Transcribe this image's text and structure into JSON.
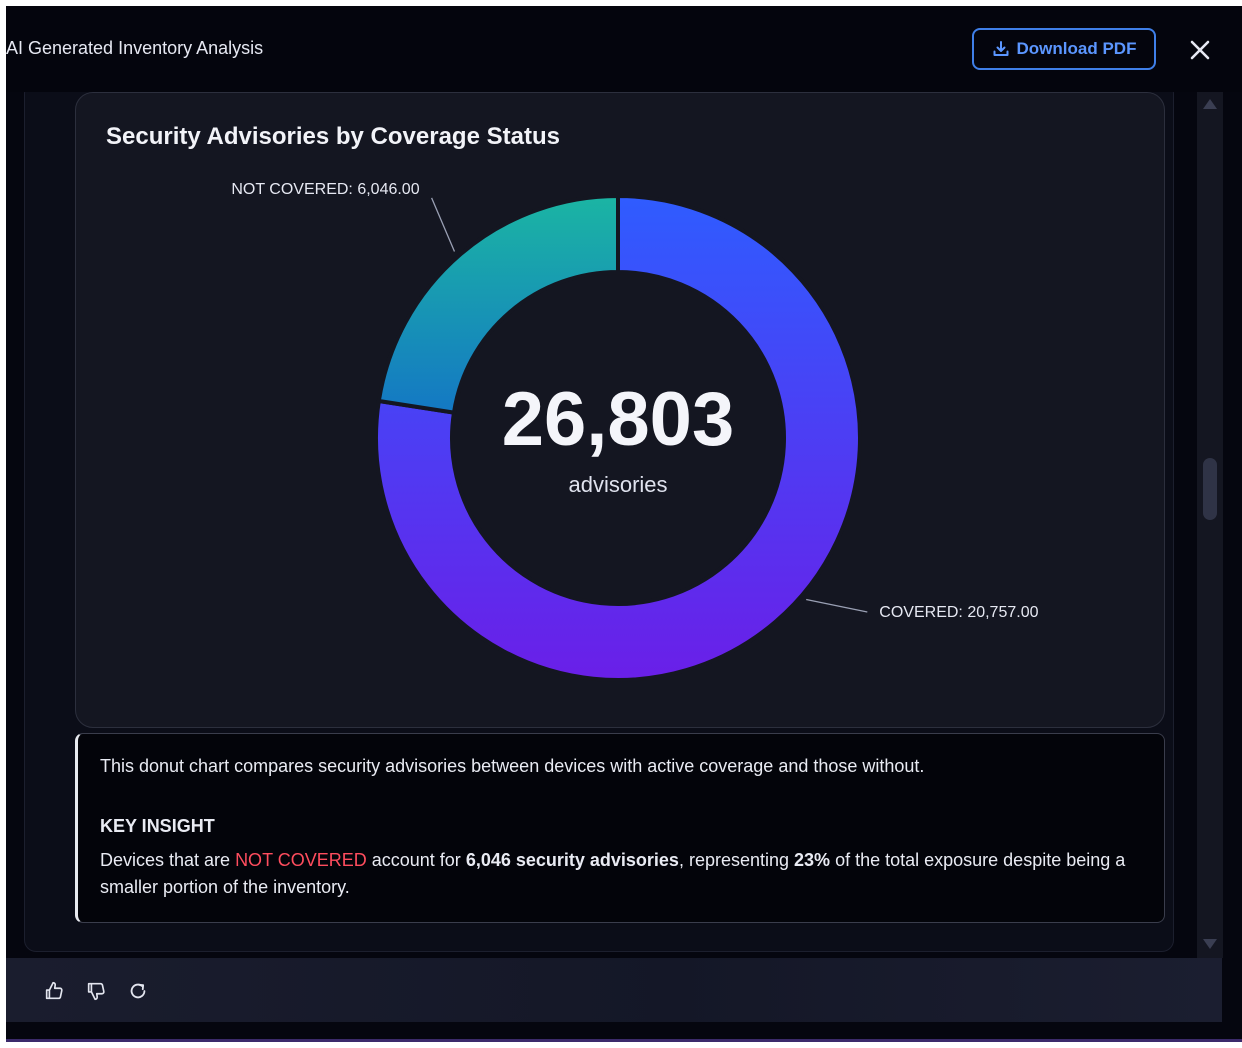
{
  "header": {
    "title": "AI Generated Inventory Analysis",
    "download_label": "Download PDF"
  },
  "chart_data": {
    "type": "pie",
    "donut": true,
    "title": "Security Advisories by Coverage Status",
    "categories": [
      "COVERED",
      "NOT COVERED"
    ],
    "values": [
      20757,
      6046
    ],
    "labels": [
      "COVERED: 20,757.00",
      "NOT COVERED: 6,046.00"
    ],
    "center_value": "26,803",
    "center_label": "advisories",
    "colors": {
      "COVERED": [
        "#2f5cff",
        "#6a1fe8"
      ],
      "NOT COVERED": [
        "#1bb5a3",
        "#1478c4"
      ]
    }
  },
  "insight": {
    "description": "This donut chart compares security advisories between devices with active coverage and those without.",
    "heading": "KEY INSIGHT",
    "text_before": "Devices that are ",
    "highlight": "NOT COVERED",
    "text_mid1": " account for ",
    "bold1": "6,046 security advisories",
    "text_mid2": ", representing ",
    "bold2": "23%",
    "text_after": " of the total exposure despite being a smaller portion of the inventory."
  },
  "footer": {
    "icons": [
      "thumbs-up-icon",
      "thumbs-down-icon",
      "refresh-icon"
    ]
  }
}
